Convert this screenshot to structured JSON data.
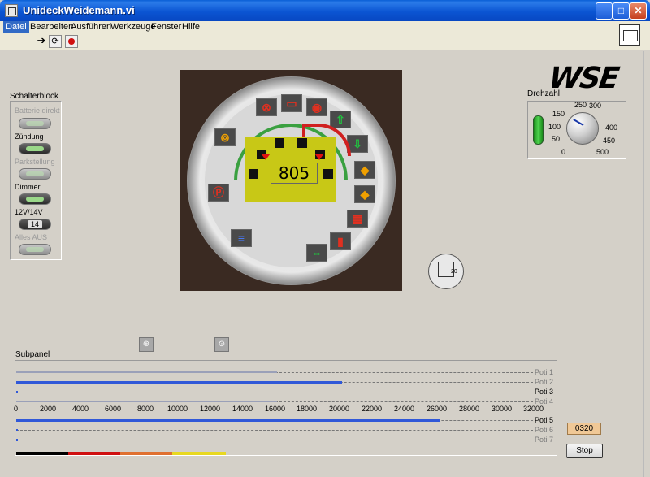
{
  "window": {
    "title": "UnideckWeidemann.vi",
    "minimize": "_",
    "maximize": "□",
    "close": "✕"
  },
  "menu": [
    "Datei",
    "Bearbeiten",
    "Ausführen",
    "Werkzeuge",
    "Fenster",
    "Hilfe"
  ],
  "toolbar": {
    "run_icon": "run-arrow-icon",
    "continuous_icon": "run-continuously-icon",
    "abort_icon": "abort-icon"
  },
  "logo": "WSE",
  "schalterblock": {
    "label": "Schalterblock",
    "switches": [
      {
        "label": "Batterie direkt",
        "state": "off",
        "enabled": false
      },
      {
        "label": "Zündung",
        "state": "on",
        "enabled": true
      },
      {
        "label": "Parkstellung",
        "state": "off",
        "enabled": false
      },
      {
        "label": "Dimmer",
        "state": "on",
        "enabled": true
      },
      {
        "label": "12V/14V",
        "state": "on",
        "enabled": true,
        "value": "14"
      },
      {
        "label": "Alles AUS",
        "state": "off",
        "enabled": false
      }
    ]
  },
  "dashboard": {
    "display_value": "805"
  },
  "drehzahl": {
    "label": "Drehzahl",
    "ticks": [
      "0",
      "50",
      "100",
      "150",
      "250",
      "300",
      "400",
      "450",
      "500"
    ],
    "value": 150
  },
  "small_gauge": {
    "value": "20"
  },
  "subpanel": {
    "label": "Subpanel",
    "potis": [
      {
        "name": "Poti 1",
        "fraction": 0.505,
        "style": "grey"
      },
      {
        "name": "Poti 2",
        "fraction": 0.63,
        "style": "blue"
      },
      {
        "name": "Poti 3",
        "fraction": 0.0,
        "style": "blue"
      },
      {
        "name": "Poti 4",
        "fraction": 0.505,
        "style": "grey"
      },
      {
        "name": "Poti 5",
        "fraction": 0.82,
        "style": "blue"
      },
      {
        "name": "Poti 6",
        "fraction": 0.0,
        "style": "blue"
      },
      {
        "name": "Poti 7",
        "fraction": 0.0,
        "style": "blue"
      }
    ],
    "axis": [
      "0",
      "2000",
      "4000",
      "6000",
      "8000",
      "10000",
      "12000",
      "14000",
      "16000",
      "18000",
      "20000",
      "22000",
      "24000",
      "26000",
      "28000",
      "30000",
      "32000"
    ]
  },
  "status": {
    "value": "0320",
    "stop_label": "Stop"
  },
  "colors": {
    "titlebar": "#0b55d3",
    "accent": "#3058d8",
    "display": "#c8c816"
  }
}
